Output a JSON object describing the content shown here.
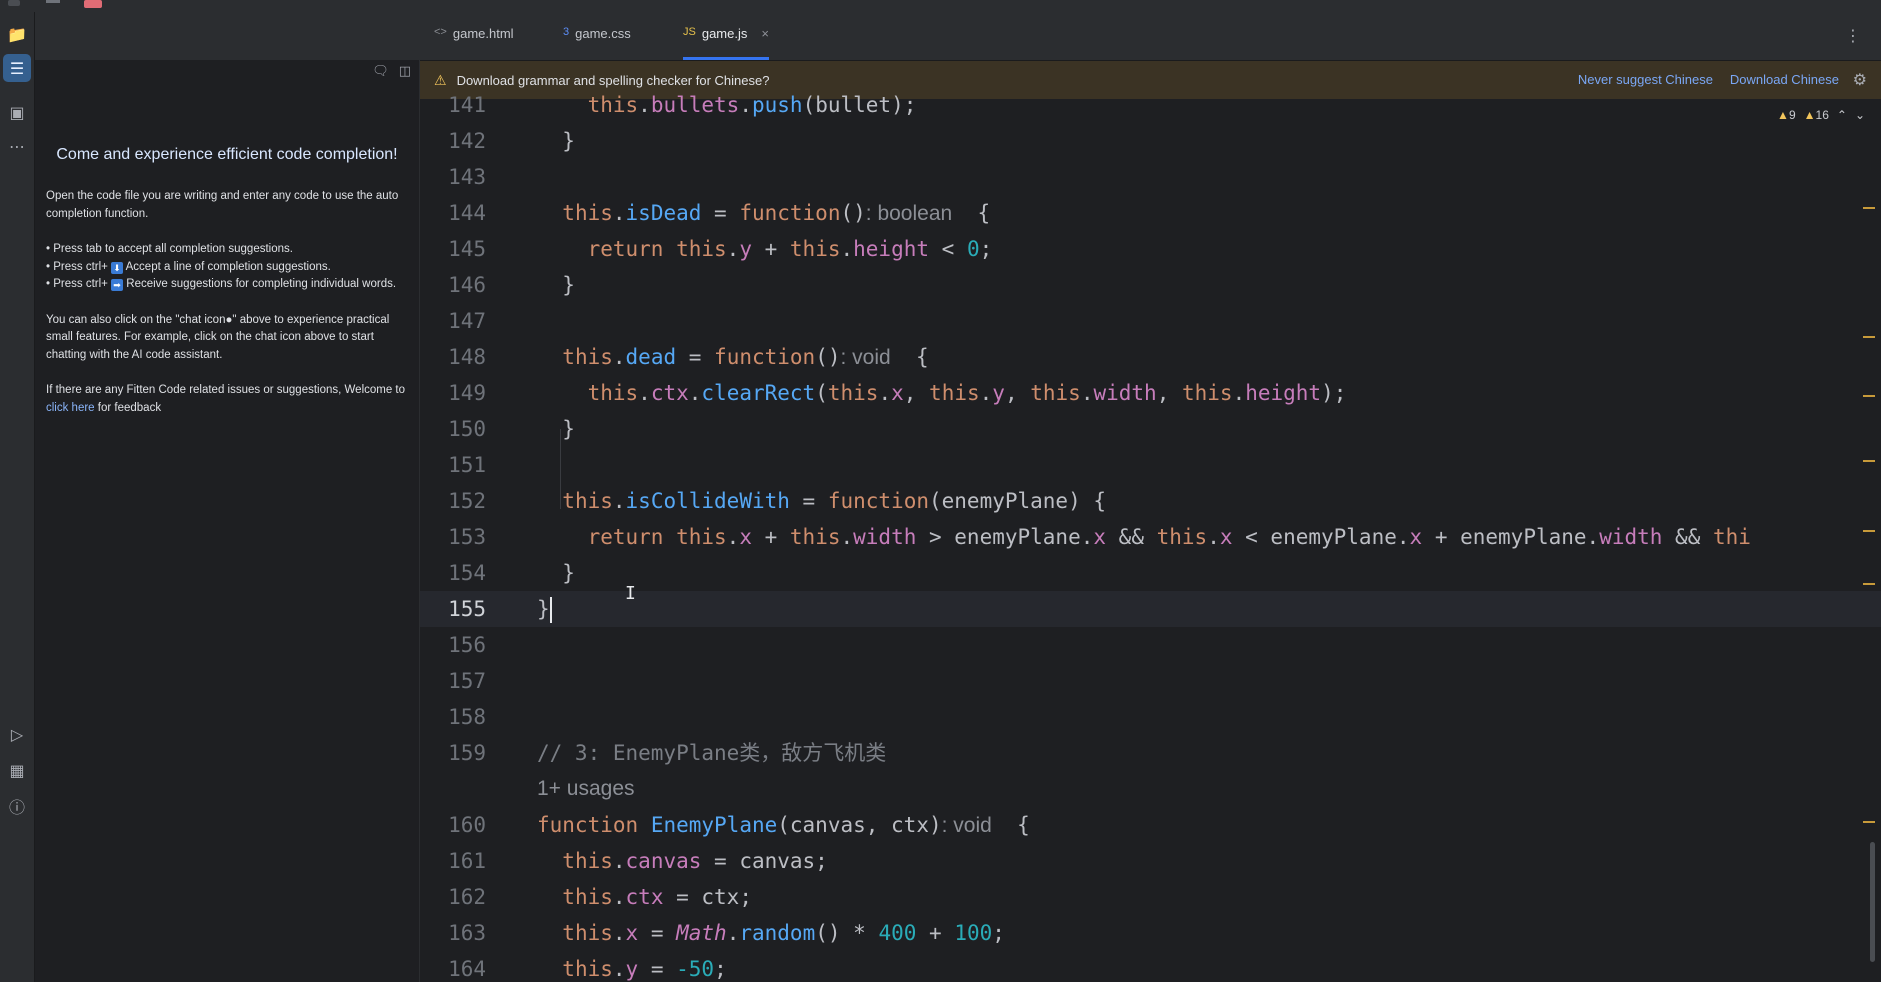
{
  "tabs": [
    {
      "icon": "<>",
      "label": "game.html"
    },
    {
      "icon": "3",
      "label": "game.css"
    },
    {
      "icon": "JS",
      "label": "game.js"
    }
  ],
  "banner": {
    "message": "Download grammar and spelling checker for Chinese?",
    "action1": "Never suggest Chinese",
    "action2": "Download Chinese"
  },
  "inspections": {
    "warnings": "9",
    "weak_warnings": "16"
  },
  "sidebar": {
    "title": "Come and experience efficient code completion!",
    "intro": "Open the code file you are writing and enter any code to use the auto completion function.",
    "bullets": [
      "Press tab to accept all completion suggestions.",
      "Accept a line of completion suggestions.",
      "Receive suggestions for completing individual words."
    ],
    "ctrl_prefix": "Press ctrl+",
    "chat_text_before": "You can also click on the \"chat icon",
    "chat_text_after": "\" above to experience practical small features. For example, click on the chat icon above to start chatting with the AI code assistant.",
    "feedback_before": "If there are any Fitten Code related issues or suggestions, Welcome to ",
    "feedback_link": "click here",
    "feedback_after": " for feedback"
  },
  "code": {
    "line_numbers": [
      "141",
      "142",
      "143",
      "144",
      "145",
      "146",
      "147",
      "148",
      "149",
      "150",
      "151",
      "152",
      "153",
      "154",
      "155",
      "156",
      "157",
      "158",
      "159",
      "160",
      "161",
      "162",
      "163",
      "164"
    ],
    "current_line": "155",
    "usages": "1+ usages",
    "hints": {
      "boolean": ": boolean",
      "void": ": void"
    },
    "comment_159": "// 3: EnemyPlane类，敌方飞机类"
  },
  "colors": {
    "accent": "#3574f0",
    "keyword": "#cf8e6d",
    "property": "#c77dbb",
    "function": "#56a8f5",
    "number": "#2aacb8",
    "warning": "#f2c55c"
  }
}
